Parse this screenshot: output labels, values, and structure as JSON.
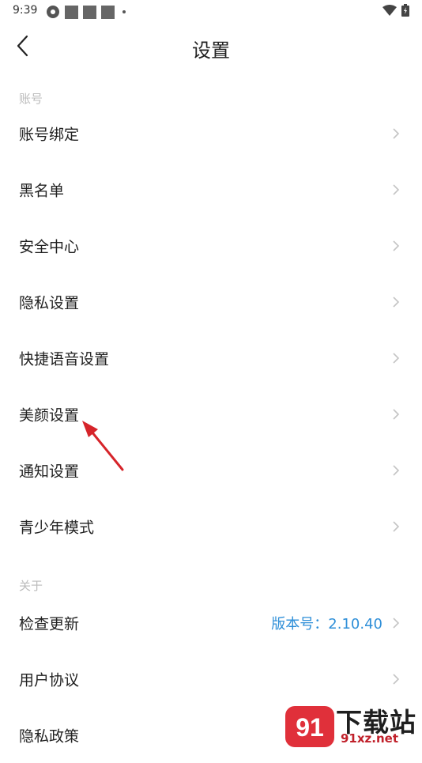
{
  "status_bar": {
    "time": "9:39"
  },
  "header": {
    "title": "设置"
  },
  "sections": {
    "account": "账号",
    "about": "关于"
  },
  "rows": [
    {
      "label": "账号绑定"
    },
    {
      "label": "黑名单"
    },
    {
      "label": "安全中心"
    },
    {
      "label": "隐私设置"
    },
    {
      "label": "快捷语音设置"
    },
    {
      "label": "美颜设置"
    },
    {
      "label": "通知设置"
    },
    {
      "label": "青少年模式"
    },
    {
      "label": "检查更新",
      "value": "版本号：2.10.40"
    },
    {
      "label": "用户协议"
    },
    {
      "label": "隐私政策"
    }
  ],
  "watermark": {
    "text": "下载站",
    "url": "91xz.net",
    "logo": "91"
  },
  "colors": {
    "accent": "#2f8fd8",
    "arrow": "#d6242a",
    "section": "#bbbbbb"
  }
}
